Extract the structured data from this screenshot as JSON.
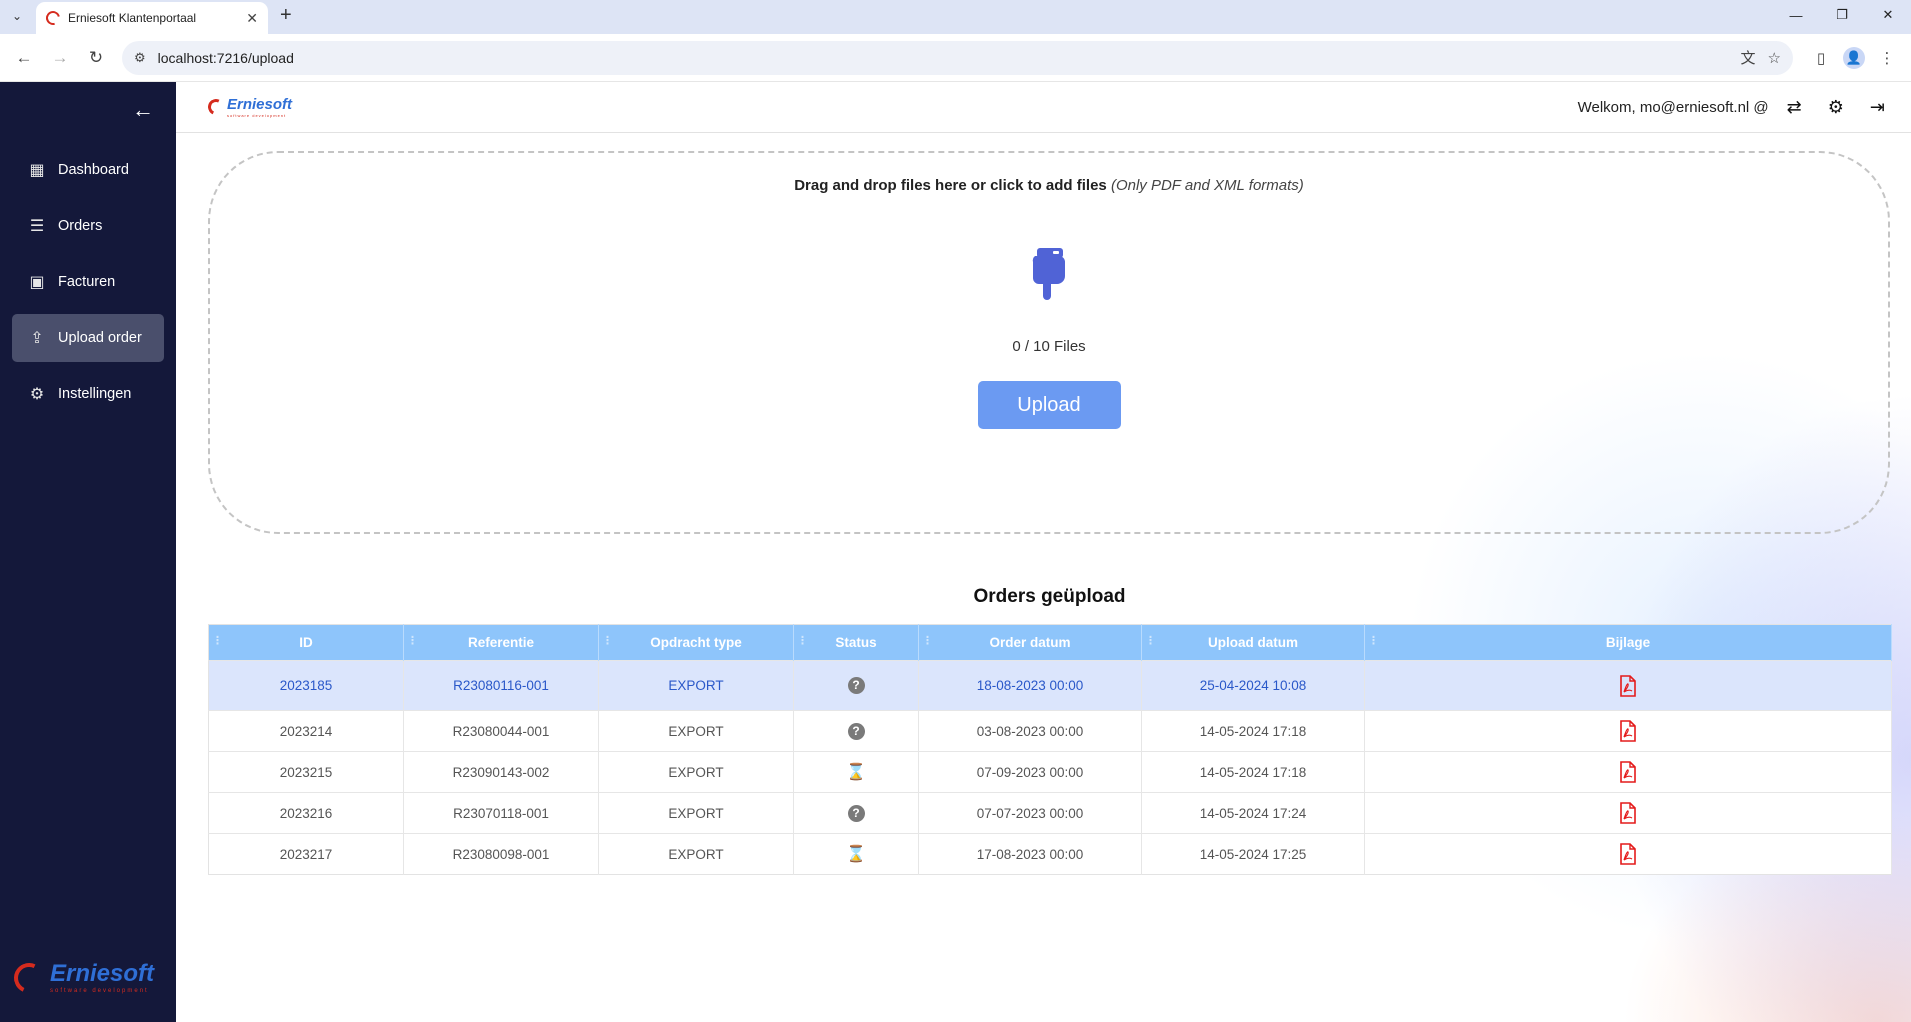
{
  "browser": {
    "tab_title": "Erniesoft Klantenportaal",
    "tab_close": "✕",
    "new_tab": "+",
    "url": "localhost:7216/upload",
    "win_min": "—",
    "win_max": "❐",
    "win_close": "✕",
    "icons": {
      "back": "←",
      "forward": "→",
      "reload": "↻",
      "site_info": "⚙",
      "translate": "文",
      "star": "☆",
      "side_panel": "▯",
      "profile": "👤",
      "menu": "⋮"
    }
  },
  "app": {
    "logo_word": "Erniesoft",
    "logo_sub": "software development",
    "welcome": "Welkom, mo@erniesoft.nl @",
    "icons": {
      "collapse": "←",
      "switch": "⇄",
      "settings": "⚙",
      "logout": "⇥"
    }
  },
  "sidebar": {
    "items": [
      {
        "label": "Dashboard",
        "icon": "▦"
      },
      {
        "label": "Orders",
        "icon": "☰"
      },
      {
        "label": "Facturen",
        "icon": "▣"
      },
      {
        "label": "Upload order",
        "icon": "⇪"
      },
      {
        "label": "Instellingen",
        "icon": "⚙"
      }
    ]
  },
  "upload": {
    "instruction_bold": "Drag and drop files here or click to add files",
    "instruction_italic": "(Only PDF and XML formats)",
    "file_count": "0 / 10 Files",
    "button_label": "Upload"
  },
  "orders": {
    "title": "Orders geüpload",
    "columns": [
      "ID",
      "Referentie",
      "Opdracht type",
      "Status",
      "Order datum",
      "Upload datum",
      "Bijlage"
    ],
    "rows": [
      {
        "id": "2023185",
        "ref": "R23080116-001",
        "type": "EXPORT",
        "status": "unknown",
        "order_date": "18-08-2023 00:00",
        "upload_date": "25-04-2024 10:08"
      },
      {
        "id": "2023214",
        "ref": "R23080044-001",
        "type": "EXPORT",
        "status": "unknown",
        "order_date": "03-08-2023 00:00",
        "upload_date": "14-05-2024 17:18"
      },
      {
        "id": "2023215",
        "ref": "R23090143-002",
        "type": "EXPORT",
        "status": "pending",
        "order_date": "07-09-2023 00:00",
        "upload_date": "14-05-2024 17:18"
      },
      {
        "id": "2023216",
        "ref": "R23070118-001",
        "type": "EXPORT",
        "status": "unknown",
        "order_date": "07-07-2023 00:00",
        "upload_date": "14-05-2024 17:24"
      },
      {
        "id": "2023217",
        "ref": "R23080098-001",
        "type": "EXPORT",
        "status": "pending",
        "order_date": "17-08-2023 00:00",
        "upload_date": "14-05-2024 17:25"
      }
    ],
    "status_glyphs": {
      "unknown": "?",
      "pending": "⌛"
    }
  },
  "colors": {
    "sidebar_bg": "#14183a",
    "active_item": "#4a4f6c",
    "table_header": "#8ec5fb",
    "selected_row": "#dbe5fc",
    "upload_button": "#6b9af2",
    "pdf_red": "#e41b1b",
    "brand_blue": "#2f6fd6",
    "brand_red": "#d52b1e"
  }
}
